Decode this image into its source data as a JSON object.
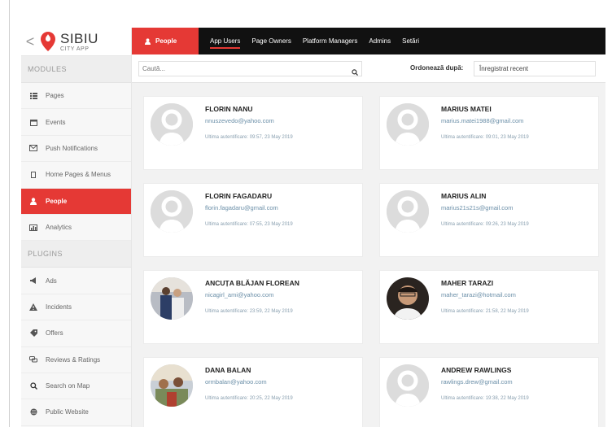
{
  "app": {
    "logo_main": "SIBIU",
    "logo_sub": "CITY APP",
    "back": "<"
  },
  "sidebar": {
    "modules_title": "MODULES",
    "modules": [
      {
        "label": "Pages",
        "icon": "list-icon"
      },
      {
        "label": "Events",
        "icon": "calendar-icon"
      },
      {
        "label": "Push Notifications",
        "icon": "message-icon"
      },
      {
        "label": "Home Pages & Menus",
        "icon": "home-icon"
      },
      {
        "label": "People",
        "icon": "person-icon"
      },
      {
        "label": "Analytics",
        "icon": "chart-icon"
      }
    ],
    "plugins_title": "PLUGINS",
    "plugins": [
      {
        "label": "Ads",
        "icon": "megaphone-icon"
      },
      {
        "label": "Incidents",
        "icon": "warning-icon"
      },
      {
        "label": "Offers",
        "icon": "tag-icon"
      },
      {
        "label": "Reviews & Ratings",
        "icon": "chat-icon"
      },
      {
        "label": "Search on Map",
        "icon": "search-icon"
      },
      {
        "label": "Public Website",
        "icon": "globe-icon"
      }
    ]
  },
  "topnav": {
    "current": "People",
    "tabs": [
      "App Users",
      "Page Owners",
      "Platform Managers",
      "Admins",
      "Setări"
    ]
  },
  "toolbar": {
    "search_placeholder": "Caută...",
    "sort_label": "Ordonează după:",
    "sort_value": "Înregistrat recent"
  },
  "accent": "#e53935",
  "users": [
    {
      "name": "FLORIN NANU",
      "email": "nnuszevedo@yahoo.com",
      "auth": "Ultima autentificare: 09:57, 23 May 2019",
      "photo": "placeholder"
    },
    {
      "name": "MARIUS MATEI",
      "email": "marius.matei1988@gmail.com",
      "auth": "Ultima autentificare: 09:01, 23 May 2019",
      "photo": "placeholder"
    },
    {
      "name": "FLORIN FAGADARU",
      "email": "florin.fagadaru@gmail.com",
      "auth": "Ultima autentificare: 07:55, 23 May 2019",
      "photo": "placeholder"
    },
    {
      "name": "MARIUS ALIN",
      "email": "marius21s21s@gmail.com",
      "auth": "Ultima autentificare: 09:26, 23 May 2019",
      "photo": "placeholder"
    },
    {
      "name": "ANCUȚA BLĂJAN FLOREAN",
      "email": "nicagirl_ami@yahoo.com",
      "auth": "Ultima autentificare: 23:59, 22 May 2019",
      "photo": "couple"
    },
    {
      "name": "MAHER TARAZI",
      "email": "maher_tarazi@hotmail.com",
      "auth": "Ultima autentificare: 21:58, 22 May 2019",
      "photo": "man"
    },
    {
      "name": "DANA BALAN",
      "email": "ormbalan@yahoo.com",
      "auth": "Ultima autentificare: 20:25, 22 May 2019",
      "photo": "group"
    },
    {
      "name": "ANDREW RAWLINGS",
      "email": "rawlings.drew@gmail.com",
      "auth": "Ultima autentificare: 19:38, 22 May 2019",
      "photo": "placeholder"
    }
  ]
}
